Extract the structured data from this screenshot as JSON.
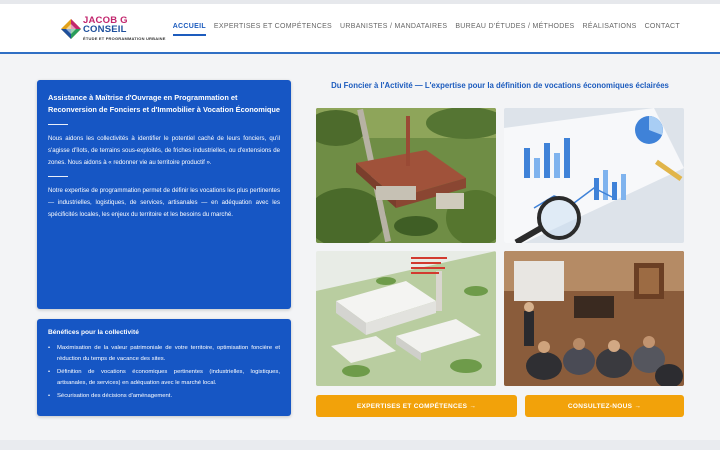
{
  "brand": {
    "line1": "JACOB G",
    "line2": "CONSEIL",
    "tagline": "ÉTUDE ET PROGRAMMATION URBAINE"
  },
  "nav": {
    "items": [
      {
        "label": "ACCUEIL",
        "active": true
      },
      {
        "label": "EXPERTISES ET COMPÉTENCES",
        "active": false
      },
      {
        "label": "URBANISTES / MANDATAIRES",
        "active": false
      },
      {
        "label": "BUREAU D'ÉTUDES / MÉTHODES",
        "active": false
      },
      {
        "label": "RÉALISATIONS",
        "active": false
      },
      {
        "label": "CONTACT",
        "active": false
      }
    ]
  },
  "intro": {
    "title": "Assistance à Maîtrise d'Ouvrage en Programmation et Reconversion de Fonciers et d'Immobilier à Vocation Économique",
    "paragraph1": "Nous aidons les collectivités à identifier le potentiel caché de leurs fonciers, qu'il s'agisse d'îlots, de terrains sous-exploités, de friches industrielles, ou d'extensions de zones. Nous aidons à « redonner vie au territoire productif ».",
    "paragraph2": "Notre expertise de programmation permet de définir les vocations les plus pertinentes — industrielles, logistiques, de services, artisanales — en adéquation avec les spécificités locales, les enjeux du territoire et les besoins du marché."
  },
  "benefits": {
    "title": "Bénéfices pour la collectivité",
    "items": [
      "Maximisation de la valeur patrimoniale de votre territoire, optimisation foncière et réduction du temps de vacance des sites.",
      "Définition de vocations économiques pertinentes (industrielles, logistiques, artisanales, de services) en adéquation avec le marché local.",
      "Sécurisation des décisions d'aménagement."
    ]
  },
  "gallery": {
    "title": "Du Foncier à l'Activité — L'expertise pour la définition de vocations économiques éclairées",
    "photos": [
      {
        "subject": "aerial-industrial-site"
      },
      {
        "subject": "charts-and-magnifier"
      },
      {
        "subject": "3d-masterplan"
      },
      {
        "subject": "workshop-meeting"
      }
    ]
  },
  "buttons": {
    "expertise": "EXPERTISES ET COMPÉTENCES →",
    "contact": "CONSULTEZ-NOUS →"
  },
  "colors": {
    "primary_blue": "#1656c4",
    "accent_orange": "#f2a20a",
    "brand_magenta": "#c2266d",
    "brand_navy": "#1d4f9c"
  }
}
